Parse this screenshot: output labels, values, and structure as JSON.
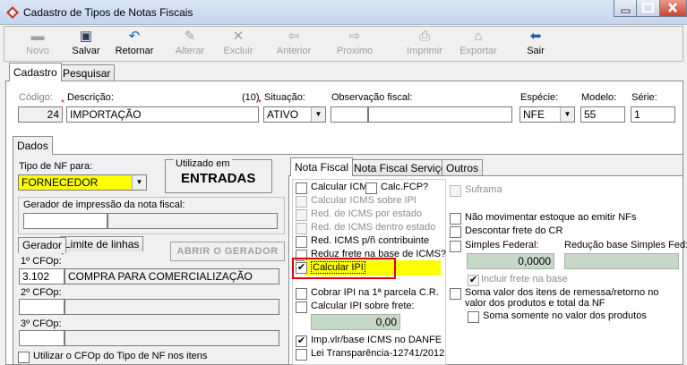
{
  "window": {
    "title": "Cadastro de Tipos de Notas Fiscais"
  },
  "toolbar": {
    "items": [
      {
        "label": "Novo",
        "icon": "new-icon",
        "enabled": false
      },
      {
        "label": "Salvar",
        "icon": "save-icon",
        "enabled": true
      },
      {
        "label": "Retornar",
        "icon": "undo-icon",
        "enabled": true
      },
      {
        "label": "Alterar",
        "icon": "edit-icon",
        "enabled": false
      },
      {
        "label": "Excluir",
        "icon": "delete-icon",
        "enabled": false
      },
      {
        "label": "Anterior",
        "icon": "arrow-left-icon",
        "enabled": false
      },
      {
        "label": "Proximo",
        "icon": "arrow-right-icon",
        "enabled": false
      },
      {
        "label": "Imprimir",
        "icon": "print-icon",
        "enabled": false
      },
      {
        "label": "Exportar",
        "icon": "export-icon",
        "enabled": false
      },
      {
        "label": "Sair",
        "icon": "exit-icon",
        "enabled": true
      }
    ]
  },
  "main_tabs": [
    "Cadastro",
    "Pesquisar"
  ],
  "header": {
    "codigo_label": "Código:",
    "codigo_value": "24",
    "descricao_label": "Descrição:",
    "descricao_count": "(10)",
    "descricao_value": "IMPORTAÇÃO",
    "situacao_label": "Situação:",
    "situacao_value": "ATIVO",
    "observacao_label": "Observação fiscal:",
    "observacao_value": "",
    "especie_label": "Espécie:",
    "especie_value": "NFE",
    "modelo_label": "Modelo:",
    "modelo_value": "55",
    "serie_label": "Série:",
    "serie_value": "1"
  },
  "dados_tab": "Dados",
  "left": {
    "tipo_label": "Tipo de NF para:",
    "tipo_value": "FORNECEDOR",
    "utilizado_label": "Utilizado em",
    "utilizado_value": "ENTRADAS",
    "gerador_label": "Gerador de impressão da nota fiscal:",
    "subtabs": [
      "Gerador",
      "Limite de linhas"
    ],
    "abrir_button": "ABRIR O GERADOR",
    "cfop1_label": "1º CFOp:",
    "cfop1_code": "3.102",
    "cfop1_desc": "COMPRA PARA COMERCIALIZAÇÃO",
    "cfop2_label": "2º CFOp:",
    "cfop3_label": "3º CFOp:",
    "utilizar_label": "Utilizar o CFOp do Tipo de NF nos itens"
  },
  "right_tabs": [
    "Nota Fiscal",
    "Nota Fiscal Serviço",
    "Outros"
  ],
  "nf": {
    "calcular_icms": "Calcular ICMS",
    "calc_fcp": "Calc.FCP?",
    "calcular_icms_ipi": "Calcular ICMS sobre IPI",
    "red_icms_estado": "Red. de ICMS por estado",
    "red_icms_dentro": "Red. de ICMS dentro estado",
    "red_icms_nao": "Red. ICMS p/ñ contribuinte",
    "reduz_frete": "Reduz frete na base de ICMS?",
    "calcular_ipi": "Calcular IPI",
    "cobrar_ipi": "Cobrar IPI na 1ª parcela C.R.",
    "calcular_ipi_frete": "Calcular IPI sobre frete:",
    "ipi_frete_value": "0,00",
    "imp_vlr": "Imp.vlr/base ICMS no DANFE",
    "lei_transp": "Lei Transparência-12741/2012",
    "suframa": "Suframa",
    "nao_movimentar": "Não movimentar estoque ao emitir NFs",
    "descontar_frete": "Descontar frete do CR",
    "simples_federal": "Simples Federal:",
    "reducao_label": "Redução base Simples Fed:",
    "simples_value": "0,0000",
    "incluir_frete": "Incluir frete na base",
    "soma_valor": "Soma valor dos itens de remessa/retorno no valor dos produtos e total da NF",
    "soma_somente": "Soma somente no valor dos produtos"
  },
  "colors": {
    "highlight": "#ffff00",
    "required": "#e00000",
    "focus_border": "#e00000"
  }
}
